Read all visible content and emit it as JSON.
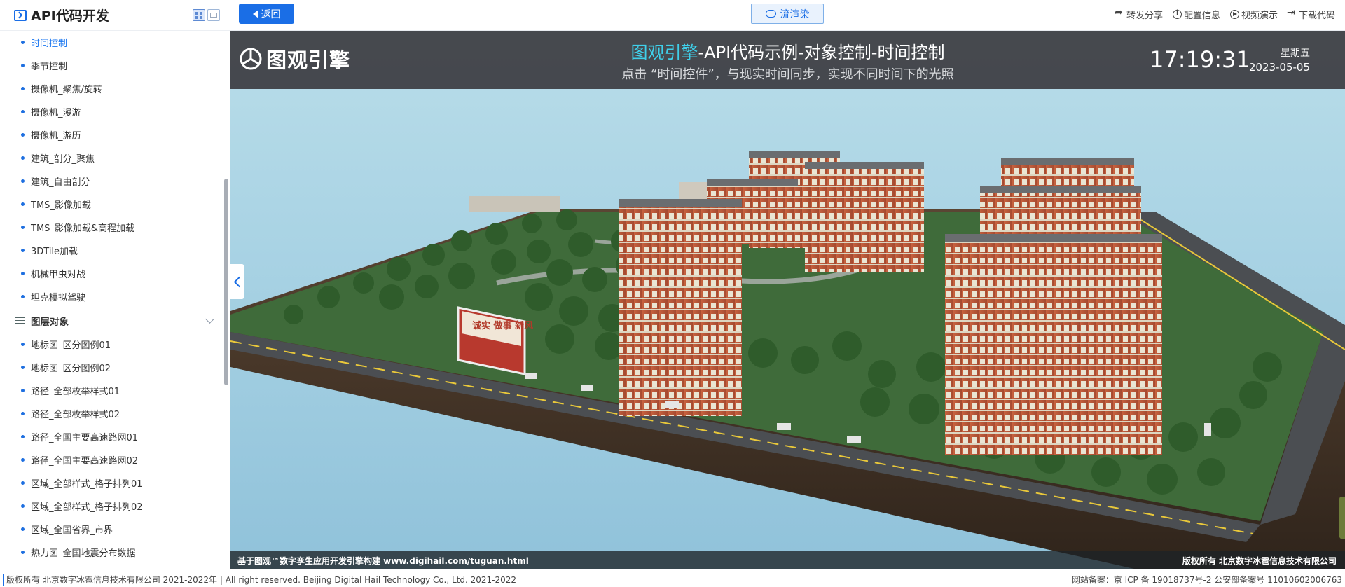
{
  "sidebar": {
    "title": "API代码开发",
    "view_icons": [
      "grid-view-icon",
      "image-view-icon"
    ],
    "items_top": [
      {
        "label": "时间控制",
        "active": true
      },
      {
        "label": "季节控制"
      },
      {
        "label": "摄像机_聚焦/旋转"
      },
      {
        "label": "摄像机_漫游"
      },
      {
        "label": "摄像机_游历"
      },
      {
        "label": "建筑_剖分_聚焦"
      },
      {
        "label": "建筑_自由剖分"
      },
      {
        "label": "TMS_影像加载"
      },
      {
        "label": "TMS_影像加载&高程加载"
      },
      {
        "label": "3DTile加载"
      },
      {
        "label": "机械甲虫对战"
      },
      {
        "label": "坦克模拟驾驶"
      }
    ],
    "group": {
      "label": "图层对象"
    },
    "items_group": [
      {
        "label": "地标图_区分图例01"
      },
      {
        "label": "地标图_区分图例02"
      },
      {
        "label": "路径_全部枚举样式01"
      },
      {
        "label": "路径_全部枚举样式02"
      },
      {
        "label": "路径_全国主要高速路网01"
      },
      {
        "label": "路径_全国主要高速路网02"
      },
      {
        "label": "区域_全部样式_格子排列01"
      },
      {
        "label": "区域_全部样式_格子排列02"
      },
      {
        "label": "区域_全国省界_市界"
      },
      {
        "label": "热力图_全国地震分布数据"
      }
    ]
  },
  "topbar": {
    "back_label": "返回",
    "stream_label": "流渲染",
    "actions": [
      {
        "label": "转发分享",
        "icon": "share-icon"
      },
      {
        "label": "配置信息",
        "icon": "info-icon"
      },
      {
        "label": "视频演示",
        "icon": "play-icon"
      },
      {
        "label": "下载代码",
        "icon": "download-icon"
      }
    ]
  },
  "viewport": {
    "logo_text": "图观引擎",
    "headline_brand": "图观引擎",
    "headline_rest": "-API代码示例-对象控制-时间控制",
    "subline": "点击 “时间控件”，与现实时间同步，实现不同时间下的光照",
    "time": "17:19:31",
    "weekday": "星期五",
    "date": "2023-05-05",
    "billboard_text": "诚实 做事 新风",
    "footer_left": "基于图观™数字孪生应用开发引擎构建 www.digihail.com/tuguan.html",
    "footer_right": "版权所有 北京数字冰雹信息技术有限公司"
  },
  "footer": {
    "left": "版权所有 北京数字冰雹信息技术有限公司 2021-2022年 | All right reserved. Beijing Digital Hail Technology Co., Ltd. 2021-2022",
    "right": "网站备案：京 ICP 备 19018737号-2 公安部备案号 11010602006763"
  },
  "colors": {
    "accent": "#1a6ee6",
    "brand_cyan": "#3fd0ea",
    "banner_bg": "#3c3c40"
  }
}
